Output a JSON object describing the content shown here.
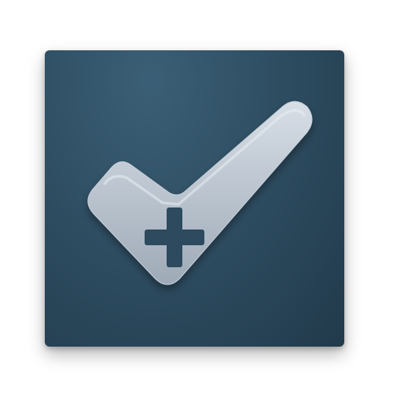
{
  "icon": {
    "name": "add-checkmark-app-icon",
    "glyph": "check-plus-icon",
    "colors": {
      "background_light": "#3b5f76",
      "background_dark": "#213a4b",
      "check_light": "#d7dee6",
      "check_dark": "#9eaab7",
      "plus": "#2d4a5e"
    }
  }
}
